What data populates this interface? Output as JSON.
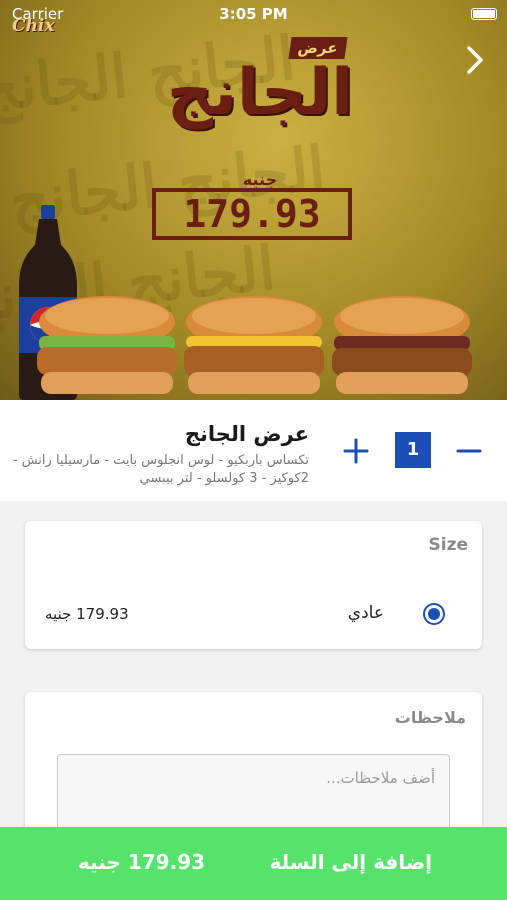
{
  "status": {
    "carrier": "Carrier",
    "time": "3:05 PM"
  },
  "brand": {
    "logo_text": "Chix"
  },
  "hero": {
    "offer_tag": "عرض",
    "offer_title": "الجانج",
    "currency": "جنيه",
    "price": "179.93"
  },
  "product": {
    "title": "عرض الجانج",
    "description": "تكساس باربكيو - لوس انجلوس بايت - مارسيليا رانش - 2كوكيز - 3 كولسلو - لتر بيبسي",
    "quantity": "1"
  },
  "size_section": {
    "heading": "Size",
    "option": {
      "label": "عادي",
      "price": "179.93 جنيه",
      "selected": true
    }
  },
  "notes_section": {
    "heading": "ملاحظات",
    "placeholder": "أضف ملاحظات..."
  },
  "cart": {
    "label": "إضافة إلى السلة",
    "price": "179.93 جنيه"
  },
  "colors": {
    "accent": "#1a4fb8",
    "cart": "#55e36c"
  }
}
